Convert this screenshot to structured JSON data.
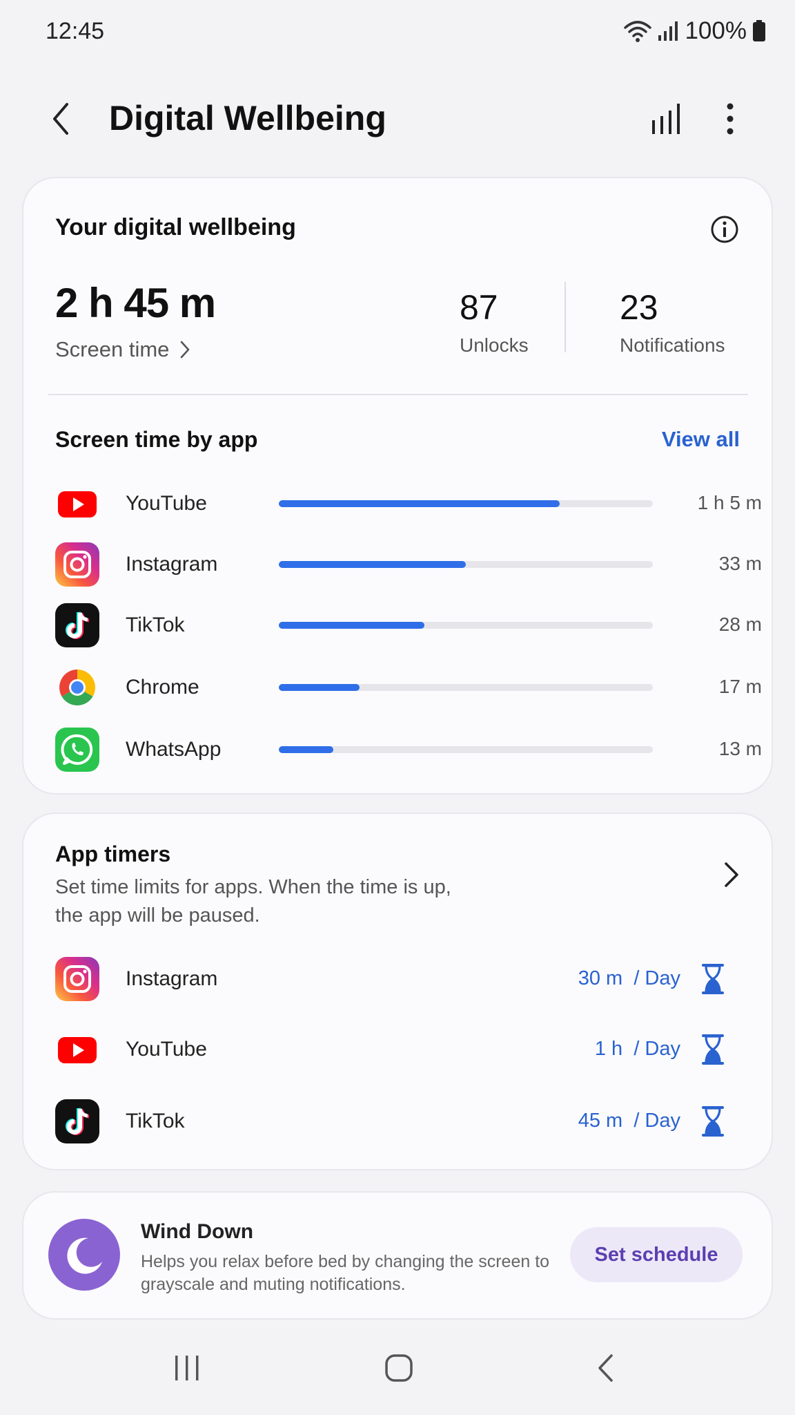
{
  "status_bar": {
    "time": "12:45",
    "battery": "100%"
  },
  "header": {
    "title": "Digital Wellbeing"
  },
  "summary": {
    "title": "Your digital wellbeing",
    "screen_time_value": "2 h 45 m",
    "screen_time_label": "Screen time",
    "unlocks_value": "87",
    "unlocks_label": "Unlocks",
    "notifications_value": "23",
    "notifications_label": "Notifications"
  },
  "screen_time_by_app": {
    "title": "Screen time by app",
    "view_all_label": "View all",
    "apps": [
      {
        "name": "YouTube",
        "time": "1 h 5 m",
        "fraction": 0.75,
        "icon": "youtube-icon"
      },
      {
        "name": "Instagram",
        "time": "33 m",
        "fraction": 0.5,
        "icon": "instagram-icon"
      },
      {
        "name": "TikTok",
        "time": "28 m",
        "fraction": 0.39,
        "icon": "tiktok-icon"
      },
      {
        "name": "Chrome",
        "time": "17 m",
        "fraction": 0.215,
        "icon": "chrome-icon"
      },
      {
        "name": "WhatsApp",
        "time": "13 m",
        "fraction": 0.145,
        "icon": "whatsapp-icon"
      }
    ]
  },
  "app_timers": {
    "title": "App timers",
    "description": "Set time limits for apps. When the time is up, the app will be paused.",
    "timers": [
      {
        "name": "Instagram",
        "time": "30 m",
        "period": "/ Day",
        "icon": "instagram-icon"
      },
      {
        "name": "YouTube",
        "time": "1 h",
        "period": "/ Day",
        "icon": "youtube-icon"
      },
      {
        "name": "TikTok",
        "time": "45 m",
        "period": "/ Day",
        "icon": "tiktok-icon"
      }
    ]
  },
  "wind_down": {
    "title": "Wind Down",
    "description": "Helps you relax before bed by changing the screen to grayscale and muting notifications.",
    "button_label": "Set schedule"
  },
  "colors": {
    "accent": "#2f6ee8",
    "link": "#2a62cf",
    "wind_down": "#8a63d2"
  }
}
